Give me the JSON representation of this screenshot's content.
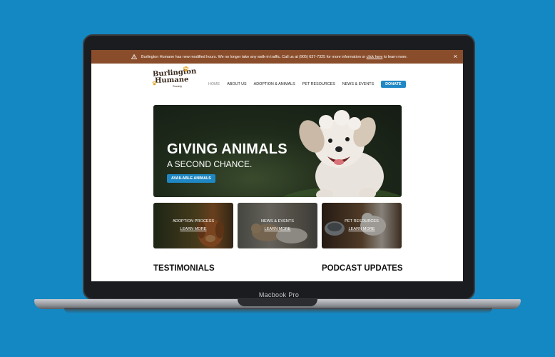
{
  "device": {
    "label": "Macbook Pro"
  },
  "alert": {
    "text": "Burlington Humane has new modified hours. We no longer take any walk-in traffic. Call us at (905) 637-7325 for more information or ",
    "link": "click here",
    "tail": " to learn more.",
    "close": "×"
  },
  "logo": {
    "line1": "Burlington",
    "line2": "Humane",
    "line3": "Society"
  },
  "nav": {
    "items": [
      "HOME",
      "ABOUT US",
      "ADOPTION & ANIMALS",
      "PET RESOURCES",
      "NEWS & EVENTS"
    ],
    "donate": "DONATE"
  },
  "hero": {
    "title": "GIVING ANIMALS",
    "subtitle": "A SECOND CHANCE.",
    "button": "AVAILABLE ANIMALS"
  },
  "cards": [
    {
      "title": "ADOPTION PROCESS",
      "link": "LEARN MORE"
    },
    {
      "title": "NEWS & EVENTS",
      "link": "LEARN MORE"
    },
    {
      "title": "PET RESOURCES",
      "link": "LEARN MORE"
    }
  ],
  "sections": {
    "testimonials": "TESTIMONIALS",
    "podcast": "PODCAST UPDATES"
  },
  "colors": {
    "background": "#1388c2",
    "alert": "#8a4d2b",
    "accent": "#1f88c4"
  }
}
